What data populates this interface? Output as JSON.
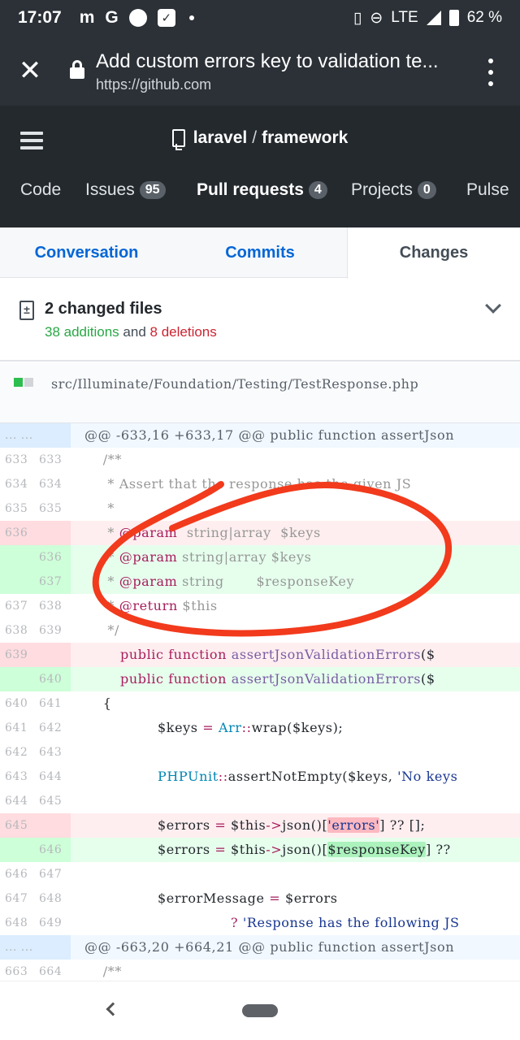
{
  "status_bar": {
    "time": "17:07",
    "app_icons": [
      "m",
      "G"
    ],
    "network": "LTE",
    "battery": "62 %"
  },
  "browser": {
    "title": "Add custom errors key to validation te...",
    "url": "https://github.com"
  },
  "repo": {
    "owner": "laravel",
    "separator": "/",
    "name": "framework"
  },
  "nav": {
    "code": "Code",
    "issues": "Issues",
    "issues_count": "95",
    "pulls": "Pull requests",
    "pulls_count": "4",
    "projects": "Projects",
    "projects_count": "0",
    "pulse": "Pulse"
  },
  "pr_tabs": {
    "conversation": "Conversation",
    "commits": "Commits",
    "changes": "Changes"
  },
  "summary": {
    "title": "2 changed files",
    "additions": "38 additions",
    "and": "and",
    "deletions": "8 deletions"
  },
  "file": {
    "path": "src/Illuminate/Foundation/Testing/TestResponse.php"
  },
  "diff": {
    "hunk1": {
      "left": "... ...",
      "text": "@@ -633,16 +633,17 @@ public function assertJson"
    },
    "hunk2": {
      "left": "... ...",
      "text": "@@ -663,20 +664,21 @@ public function assertJson"
    },
    "lines": {
      "l633": {
        "old": "633",
        "new": "633",
        "code": "    /**"
      },
      "l634": {
        "old": "634",
        "new": "634",
        "code": "     * Assert that the response has the given JS"
      },
      "l635": {
        "old": "635",
        "new": "635",
        "code": "     *"
      },
      "l636d": {
        "old": "636",
        "pre": "     * ",
        "tag": "@param",
        "rest": "  string|array  $keys"
      },
      "l636a": {
        "new": "636",
        "pre": "     * ",
        "tag": "@param",
        "rest": " string|array $keys"
      },
      "l637a": {
        "new": "637",
        "pre": "     * ",
        "tag": "@param",
        "rest": " string       $responseKey"
      },
      "l637": {
        "old": "637",
        "new": "638",
        "pre": "     * ",
        "tag": "@return",
        "rest": " $this"
      },
      "l638": {
        "old": "638",
        "new": "639",
        "code": "     */"
      },
      "l639d": {
        "old": "639",
        "kw1": "public",
        "kw2": "function",
        "fn": "assertJsonValidationErrors",
        "tail": "($"
      },
      "l640a": {
        "new": "640",
        "kw1": "public",
        "kw2": "function",
        "fn": "assertJsonValidationErrors",
        "tail": "($"
      },
      "l640": {
        "old": "640",
        "new": "641",
        "code": "    {"
      },
      "l641": {
        "old": "641",
        "new": "642",
        "var": "$keys",
        "eq": "=",
        "cls": "Arr",
        "op": "::",
        "rest": "wrap($keys);"
      },
      "l642": {
        "old": "642",
        "new": "643"
      },
      "l643": {
        "old": "643",
        "new": "644",
        "cls": "PHPUnit",
        "op": "::",
        "rest": "assertNotEmpty($keys, ",
        "str": "'No keys"
      },
      "l644": {
        "old": "644",
        "new": "645"
      },
      "l645d": {
        "old": "645",
        "var": "$errors",
        "eq": "=",
        "this": "$this",
        "arrow": "->",
        "call": "json()[",
        "key": "'errors'",
        "tail": "] ?? [];"
      },
      "l646a": {
        "new": "646",
        "var": "$errors",
        "eq": "=",
        "this": "$this",
        "arrow": "->",
        "call": "json()[",
        "key": "$responseKey",
        "tail": "] ??"
      },
      "l646": {
        "old": "646",
        "new": "647"
      },
      "l647": {
        "old": "647",
        "new": "648",
        "var": "$errorMessage",
        "eq": "=",
        "rest": "$errors"
      },
      "l648": {
        "old": "648",
        "new": "649",
        "q": "?",
        "str": "'Response has the following JS"
      },
      "l663": {
        "old": "663",
        "new": "664",
        "code": "    /**"
      }
    }
  },
  "colors": {
    "header": "#24292e",
    "link": "#0366d6",
    "addition": "#28a745",
    "deletion": "#cb2431",
    "annotation": "#f23a1c"
  }
}
